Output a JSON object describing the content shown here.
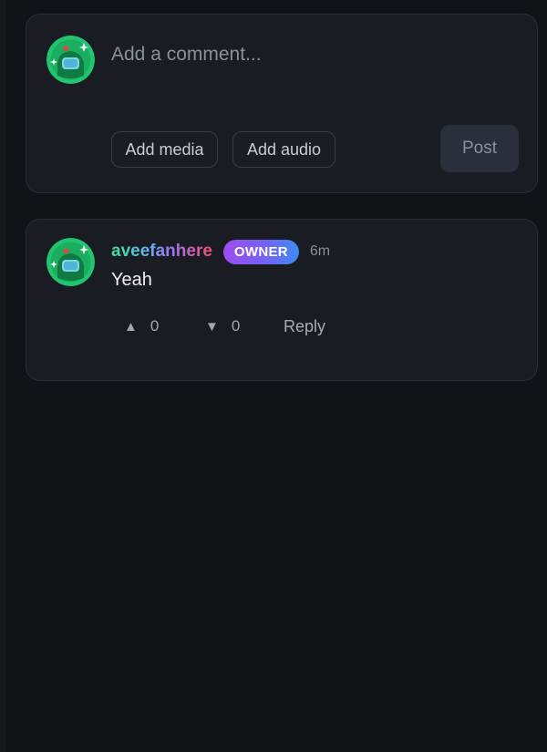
{
  "composer": {
    "placeholder": "Add a comment...",
    "add_media_label": "Add media",
    "add_audio_label": "Add audio",
    "post_label": "Post"
  },
  "comments": [
    {
      "username": "aveefanhere",
      "badge": "OWNER",
      "timestamp": "6m",
      "body": "Yeah",
      "upvotes": "0",
      "downvotes": "0",
      "reply_label": "Reply",
      "upvote_icon": "▲",
      "downvote_icon": "▼"
    }
  ],
  "colors": {
    "background": "#121316",
    "card": "#1a1c23",
    "badge_start": "#a04cf0",
    "badge_end": "#3d8cf2",
    "avatar_green": "#1fbf6a"
  }
}
